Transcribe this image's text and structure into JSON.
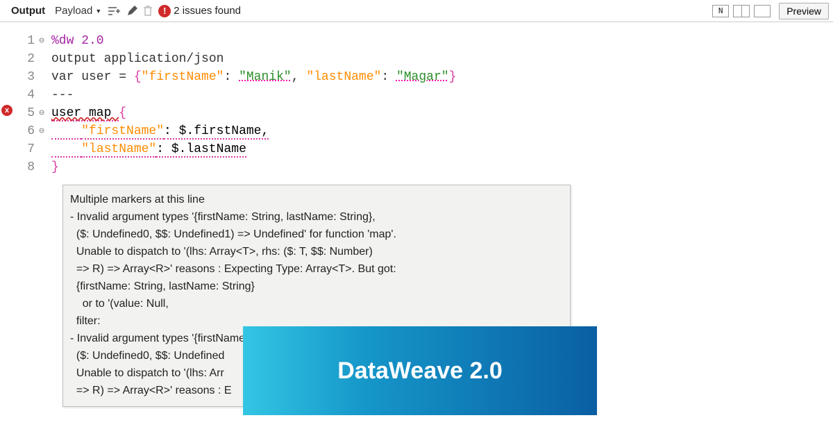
{
  "toolbar": {
    "tab_output": "Output",
    "dropdown_label": "Payload",
    "issues_badge": "!",
    "issues_text": "2 issues found",
    "icon_n_label": "N",
    "preview_label": "Preview"
  },
  "gutter_error_badge": "x",
  "code": {
    "lines": [
      {
        "ln": "1",
        "fold": "⊖",
        "segs": [
          {
            "cls": "purple",
            "t": "%dw 2.0"
          }
        ]
      },
      {
        "ln": "2",
        "fold": "",
        "segs": [
          {
            "cls": "kw",
            "t": "output application/json"
          }
        ]
      },
      {
        "ln": "3",
        "fold": "",
        "segs": [
          {
            "cls": "kw",
            "t": "var user = "
          },
          {
            "cls": "brace",
            "t": "{"
          },
          {
            "cls": "str",
            "t": "\"firstName\""
          },
          {
            "cls": "kw",
            "t": ": "
          },
          {
            "cls": "val",
            "t": "\"Manik\""
          },
          {
            "cls": "kw",
            "t": ", "
          },
          {
            "cls": "str",
            "t": "\"lastName\""
          },
          {
            "cls": "kw",
            "t": ": "
          },
          {
            "cls": "val",
            "t": "\"Magar\""
          },
          {
            "cls": "brace",
            "t": "}"
          }
        ]
      },
      {
        "ln": "4",
        "fold": "",
        "segs": [
          {
            "cls": "kw",
            "t": "---"
          }
        ]
      },
      {
        "ln": "5",
        "fold": "⊖",
        "segs": [
          {
            "cls": "err-under",
            "t": "user map "
          },
          {
            "cls": "brace",
            "t": "{"
          }
        ]
      },
      {
        "ln": "6",
        "fold": "⊖",
        "segs": [
          {
            "cls": "dotunder",
            "t": "    "
          },
          {
            "cls": "str dotunder",
            "t": "\"firstName\""
          },
          {
            "cls": "dotunder",
            "t": ": $.firstName,"
          }
        ]
      },
      {
        "ln": "7",
        "fold": "",
        "segs": [
          {
            "cls": "dotunder",
            "t": "    "
          },
          {
            "cls": "str dotunder",
            "t": "\"lastName\""
          },
          {
            "cls": "dotunder",
            "t": ": $.lastName"
          }
        ]
      },
      {
        "ln": "8",
        "fold": "",
        "segs": [
          {
            "cls": "brace",
            "t": "}"
          }
        ]
      }
    ]
  },
  "tooltip": {
    "header": "Multiple markers at this line",
    "lines": [
      "- Invalid argument types '{firstName: String, lastName: String},",
      "  ($: Undefined0, $$: Undefined1) => Undefined' for function 'map'.",
      "  Unable to dispatch to '(lhs: Array<T>, rhs: ($: T, $$: Number)",
      "  => R) => Array<R>' reasons : Expecting Type: Array<T>. But got:",
      "  {firstName: String, lastName: String}",
      "    or to '(value: Null,",
      "  filter:",
      "- Invalid argument types '{firstName: String, lastName: String},",
      "  ($: Undefined0, $$: Undefined",
      "  Unable to dispatch to '(lhs: Arr",
      "  => R) => Array<R>' reasons : E"
    ]
  },
  "banner": "DataWeave 2.0"
}
